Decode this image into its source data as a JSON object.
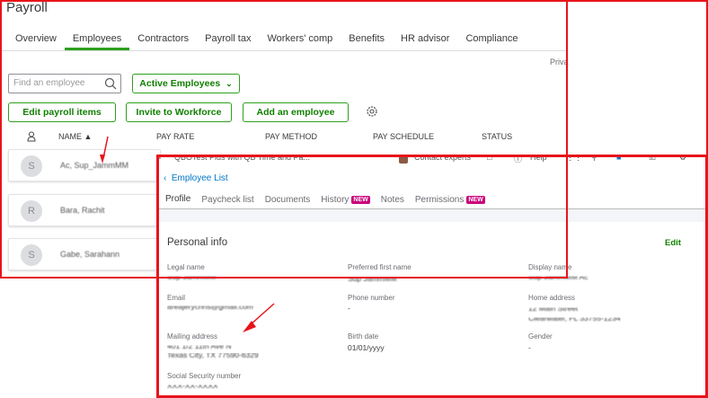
{
  "payroll": {
    "title": "Payroll",
    "tabs": [
      "Overview",
      "Employees",
      "Contractors",
      "Payroll tax",
      "Workers' comp",
      "Benefits",
      "HR advisor",
      "Compliance"
    ],
    "active_tab": "Employees",
    "privacy_text": "Priva",
    "search_placeholder": "Find an employee",
    "filter_label": "Active Employees",
    "buttons": {
      "edit_items": "Edit payroll items",
      "invite": "Invite to Workforce",
      "add": "Add an employee"
    },
    "columns": [
      "NAME ▲",
      "PAY RATE",
      "PAY METHOD",
      "PAY SCHEDULE",
      "STATUS"
    ],
    "employees": [
      {
        "initial": "S",
        "name": "Ac, Sup_JammMM"
      },
      {
        "initial": "R",
        "name": "Bara, Rachit"
      },
      {
        "initial": "S",
        "name": "Gabe, Sarahann"
      }
    ]
  },
  "panel": {
    "company": "QBOTest Plus with QB Time and Pa...",
    "contact": "Contact experts",
    "help": "Help",
    "back": "Employee List",
    "tabs": [
      {
        "label": "Profile",
        "badge": null
      },
      {
        "label": "Paycheck list",
        "badge": null
      },
      {
        "label": "Documents",
        "badge": null
      },
      {
        "label": "History",
        "badge": "NEW"
      },
      {
        "label": "Notes",
        "badge": null
      },
      {
        "label": "Permissions",
        "badge": "NEW"
      }
    ],
    "section_title": "Personal info",
    "edit": "Edit",
    "fields": {
      "legal_name": {
        "label": "Legal name",
        "value": "Sup JammMM"
      },
      "preferred": {
        "label": "Preferred first name",
        "value": "Sup JammMM"
      },
      "display": {
        "label": "Display name",
        "value": "Sup JammMM Ac"
      },
      "email": {
        "label": "Email",
        "value": "areajerychris@gmail.com"
      },
      "phone": {
        "label": "Phone number",
        "value": "-"
      },
      "home": {
        "label": "Home address",
        "value1": "12 Main Street",
        "value2": "Clearwater, FL 33755-1234"
      },
      "mailing": {
        "label": "Mailing address",
        "value1": "401 1/2 11th Ave N",
        "value2": "Texas City, TX 77590-6329"
      },
      "birth": {
        "label": "Birth date",
        "value": "01/01/yyyy"
      },
      "gender": {
        "label": "Gender",
        "value": "-"
      },
      "ssn": {
        "label": "Social Security number",
        "value": "XXX-XX-XXXX"
      }
    }
  },
  "colors": {
    "accent": "#2ca01c",
    "annotation": "#e8141b",
    "badge": "#c9007a"
  }
}
